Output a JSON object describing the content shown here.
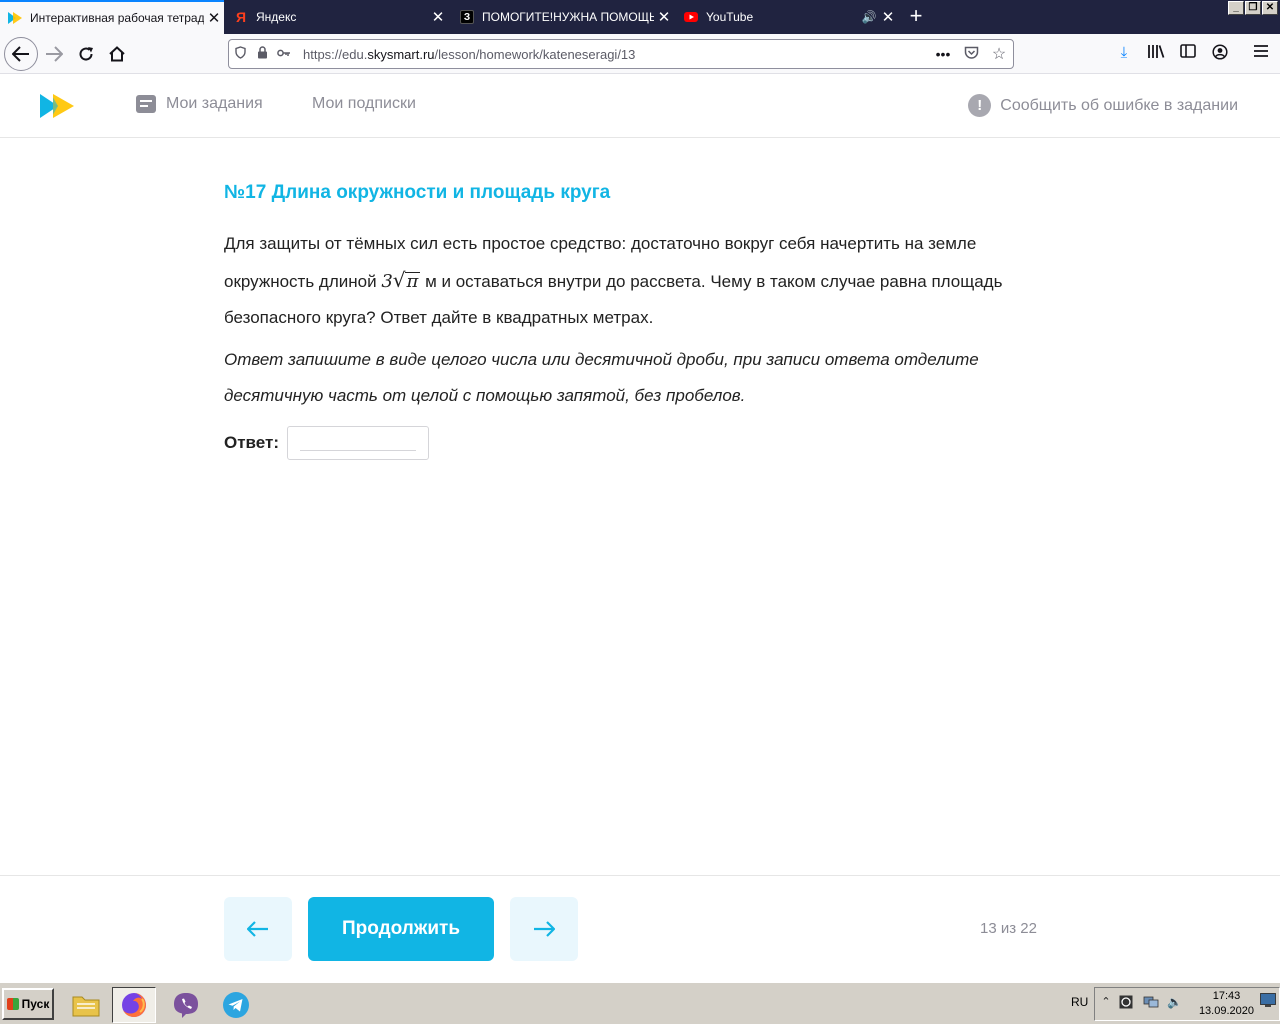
{
  "browser": {
    "tabs": [
      {
        "title": "Интерактивная рабочая тетрадь",
        "active": true,
        "favicon": "skysmart-icon"
      },
      {
        "title": "Яндекс",
        "active": false,
        "favicon": "yandex-icon"
      },
      {
        "title": "ПОМОГИТЕ!НУЖНА ПОМОЩЬ В М",
        "active": false,
        "favicon": "znanija-icon"
      },
      {
        "title": "YouTube",
        "active": false,
        "favicon": "youtube-icon",
        "audio": true
      }
    ],
    "url_prefix": "https://edu.",
    "url_domain": "skysmart.ru",
    "url_path": "/lesson/homework/kateneseragi/13"
  },
  "site": {
    "nav": {
      "my_tasks": "Мои задания",
      "my_subscriptions": "Мои подписки",
      "report_error": "Сообщить об ошибке в задании"
    },
    "accent_color": "#11b5e4"
  },
  "task": {
    "title": "№17 Длина окружности и площадь круга",
    "text_before": "Для защиты от тёмных сил есть простое средство: достаточно вокруг себя начертить на земле окружность длиной ",
    "math_coef": "3",
    "math_radicand": "π",
    "text_after": " м и оставаться внутри до рассвета. Чему в таком случае равна площадь безопасного круга? Ответ дайте в квадратных метрах.",
    "hint": "Ответ запишите в виде целого числа или десятичной дроби, при записи ответа отделите десятичную часть от целой с помощью запятой, без пробелов.",
    "answer_label": "Ответ:",
    "answer_value": ""
  },
  "footer": {
    "continue_label": "Продолжить",
    "progress": "13 из 22"
  },
  "taskbar": {
    "start_label": "Пуск",
    "language": "RU",
    "time": "17:43",
    "date": "13.09.2020"
  }
}
